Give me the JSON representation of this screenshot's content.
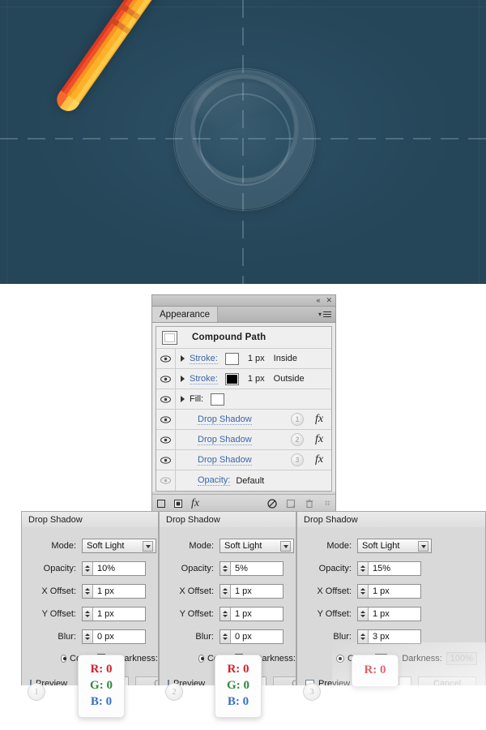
{
  "hero": {
    "name": "magnifying-glass-illustration",
    "background_color": "#254558",
    "handle_colors": [
      "#ffc949",
      "#ffb129",
      "#f79420",
      "#ef4f2a",
      "#e0381f"
    ],
    "lens_color": "#b9cfdc"
  },
  "panel": {
    "titlebar": {
      "collapse_icon": "«",
      "close_icon": "✕"
    },
    "tab_label": "Appearance",
    "menu_icon": "panel-menu-icon",
    "header_row": {
      "title": "Compound Path",
      "swatch": "#ffffff"
    },
    "rows": [
      {
        "type": "stroke",
        "label": "Stroke:",
        "link": true,
        "swatch": "#ffffff",
        "width": "1 px",
        "position": "Inside",
        "visible": true,
        "expandable": true
      },
      {
        "type": "stroke",
        "label": "Stroke:",
        "link": true,
        "swatch": "#000000",
        "width": "1 px",
        "position": "Outside",
        "visible": true,
        "expandable": true
      },
      {
        "type": "fill",
        "label": "Fill:",
        "link": false,
        "swatch": "#ffffff",
        "width": "",
        "position": "",
        "visible": true,
        "expandable": true
      }
    ],
    "effects": [
      {
        "label": "Drop Shadow",
        "badge": "1",
        "fx": "fx",
        "visible": true
      },
      {
        "label": "Drop Shadow",
        "badge": "2",
        "fx": "fx",
        "visible": true
      },
      {
        "label": "Drop Shadow",
        "badge": "3",
        "fx": "fx",
        "visible": true
      }
    ],
    "opacity_row": {
      "label": "Opacity:",
      "value": "Default",
      "visible": false
    },
    "footer_icons": [
      "add-new-stroke-icon",
      "add-new-fill-icon",
      "add-new-effect-icon",
      "clear-appearance-icon",
      "duplicate-item-icon",
      "delete-item-icon",
      "resize-grip-icon"
    ],
    "footer_fx_label": "fx"
  },
  "dialogs": [
    {
      "step": "1",
      "title": "Drop Shadow",
      "fields": {
        "mode_label": "Mode:",
        "mode_value": "Soft Light",
        "opacity_label": "Opacity:",
        "opacity_value": "10%",
        "x_offset_label": "X Offset:",
        "x_offset_value": "1 px",
        "y_offset_label": "Y Offset:",
        "y_offset_value": "1 px",
        "blur_label": "Blur:",
        "blur_value": "0 px",
        "color_label": "Color:",
        "color_value": "#000000",
        "darkness_label": "Darkness:",
        "darkness_value": "",
        "preview_label": "Preview",
        "ok_label": "",
        "cancel_label": "C"
      },
      "rgb": {
        "r": "R: 0",
        "g": "G: 0",
        "b": "B: 0"
      }
    },
    {
      "step": "2",
      "title": "Drop Shadow",
      "fields": {
        "mode_label": "Mode:",
        "mode_value": "Soft Light",
        "opacity_label": "Opacity:",
        "opacity_value": "5%",
        "x_offset_label": "X Offset:",
        "x_offset_value": "1 px",
        "y_offset_label": "Y Offset:",
        "y_offset_value": "1 px",
        "blur_label": "Blur:",
        "blur_value": "0 px",
        "color_label": "Color:",
        "color_value": "#000000",
        "darkness_label": "Darkness:",
        "darkness_value": "",
        "preview_label": "Preview",
        "ok_label": "",
        "cancel_label": "C"
      },
      "rgb": {
        "r": "R: 0",
        "g": "G: 0",
        "b": "B: 0"
      }
    },
    {
      "step": "3",
      "title": "Drop Shadow",
      "fields": {
        "mode_label": "Mode:",
        "mode_value": "Soft Light",
        "opacity_label": "Opacity:",
        "opacity_value": "15%",
        "x_offset_label": "X Offset:",
        "x_offset_value": "1 px",
        "y_offset_label": "Y Offset:",
        "y_offset_value": "1 px",
        "blur_label": "Blur:",
        "blur_value": "3 px",
        "color_label": "Color:",
        "color_value": "#000000",
        "darkness_label": "Darkness:",
        "darkness_value": "100%",
        "preview_label": "Preview",
        "ok_label": "",
        "cancel_label": "Cancel"
      },
      "rgb": {
        "r": "R: 0",
        "g": "",
        "b": ""
      }
    }
  ]
}
